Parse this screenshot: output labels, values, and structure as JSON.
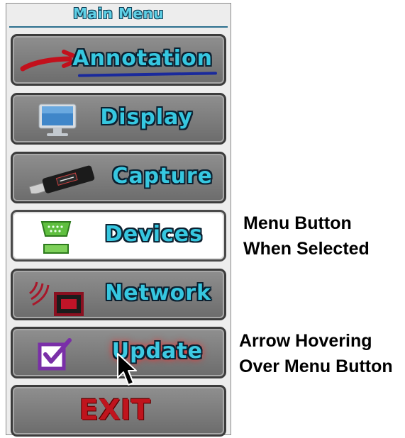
{
  "panel": {
    "title": "Main Menu"
  },
  "menu": {
    "items": [
      {
        "label": "Annotation",
        "icon": "red-arrow-icon"
      },
      {
        "label": "Display",
        "icon": "monitor-icon"
      },
      {
        "label": "Capture",
        "icon": "usb-stick-icon"
      },
      {
        "label": "Devices",
        "icon": "serial-port-icon",
        "state": "selected"
      },
      {
        "label": "Network",
        "icon": "network-icon"
      },
      {
        "label": "Update",
        "icon": "checkbox-icon",
        "state": "hover"
      },
      {
        "label": "EXIT"
      }
    ]
  },
  "callouts": {
    "selected_line1": "Menu Button",
    "selected_line2": "When Selected",
    "hover_line1": "Arrow Hovering",
    "hover_line2": "Over Menu Button"
  },
  "colors": {
    "label_cyan": "#36c7e0",
    "label_outline": "#0b2030",
    "exit_red": "#c0141d",
    "hover_glow": "#ff2a2a",
    "button_gray": "#7c7c7c",
    "selected_bg": "#ffffff"
  }
}
